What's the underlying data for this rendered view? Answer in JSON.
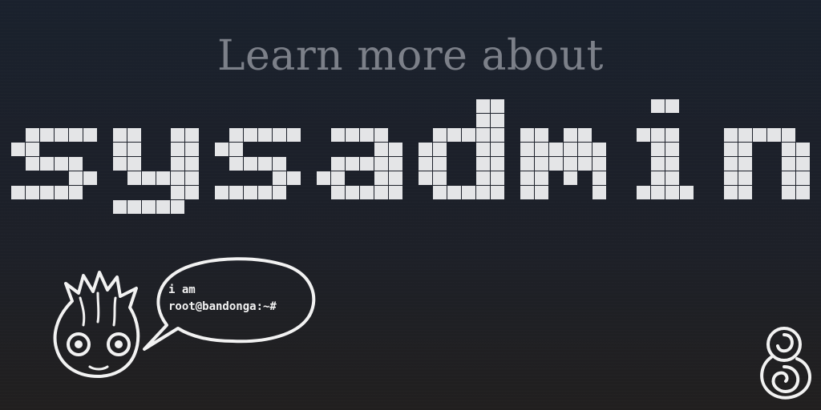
{
  "banner": {
    "tagline": "Learn more about",
    "headline": "sysadmin",
    "bubble": {
      "line1": "i am",
      "line2": "root@bandonga:~#"
    },
    "colors": {
      "background_top": "#1a212d",
      "background_bottom": "#211f1f",
      "tagline": "#7c8089",
      "headline": "#e4e5e7",
      "outline": "#f2f2f2"
    },
    "icons": {
      "mascot": "groot-face-icon",
      "speech_bubble": "speech-bubble-icon",
      "logo": "spiral-eight-logo-icon"
    }
  }
}
